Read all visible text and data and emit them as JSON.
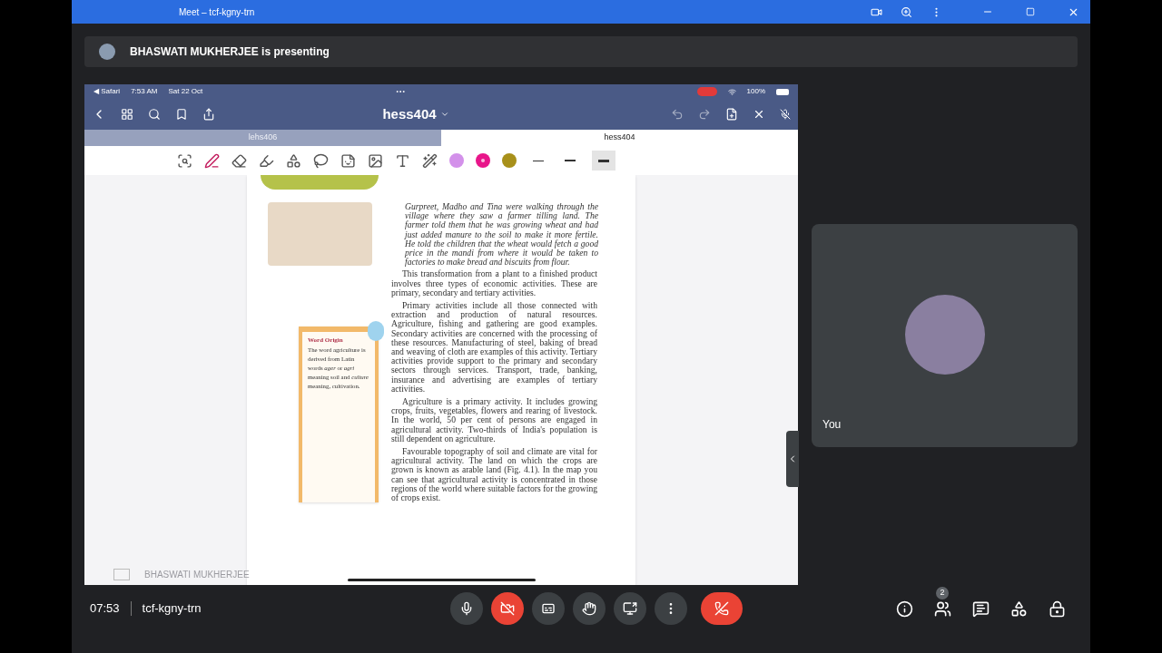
{
  "window": {
    "title": "Meet – tcf-kgny-trn"
  },
  "presenting_banner": {
    "text": "BHASWATI MUKHERJEE is presenting"
  },
  "shared_screen": {
    "status_bar": {
      "app": "◀ Safari",
      "time": "7:53 AM",
      "date": "Sat 22 Oct",
      "battery": "100%"
    },
    "document_title": "hess404",
    "tabs": [
      {
        "label": "lehs406",
        "selected": false
      },
      {
        "label": "hess404",
        "selected": true
      }
    ],
    "pen_colors": [
      {
        "color": "#d391ea",
        "selected": false
      },
      {
        "color": "#e8168a",
        "selected": true
      },
      {
        "color": "#a8901a",
        "selected": false
      }
    ],
    "stroke_widths": [
      {
        "selected": false
      },
      {
        "selected": false
      },
      {
        "selected": true
      }
    ],
    "page": {
      "intro": "Gurpreet, Madho and Tina were walking through the village where they saw a farmer tilling land. The farmer told them that he was growing wheat and had just added manure to the soil to make it more fertile. He told the children that the wheat would fetch a good price in the mandi from where it would be taken to factories to make bread and biscuits from flour.",
      "paragraphs": [
        "This transformation from a plant to a finished product involves three types of economic activities. These are primary, secondary and tertiary activities.",
        "Primary activities include all those connected with extraction and production of natural resources. Agriculture, fishing and gathering are good examples. Secondary activities are concerned with the processing of these resources. Manufacturing of steel, baking of bread and weaving of cloth are examples of this activity. Tertiary activities provide support to the primary and secondary sectors through services. Transport, trade, banking, insurance and advertising are examples of tertiary activities.",
        "Agriculture is a primary activity. It includes growing crops, fruits, vegetables, flowers and rearing of livestock. In the world, 50 per cent of persons are engaged in agricultural activity. Two-thirds of India's population is still dependent on agriculture.",
        "Favourable topography of soil and climate are vital for agricultural activity. The land on which the crops are grown is known as arable land (Fig. 4.1). In the map you can see that agricultural activity is concentrated in those regions of the world where suitable factors for the growing of crops exist."
      ],
      "word_origin": {
        "title": "Word Origin",
        "text": "The word agriculture is derived from Latin words *ager* or *agri* meaning soil and *culture* meaning, cultivation."
      }
    },
    "presenter_label": "BHASWATI MUKHERJEE"
  },
  "participant": {
    "name": "You"
  },
  "bottom_bar": {
    "time": "07:53",
    "meeting_code": "tcf-kgny-trn",
    "controls": [
      {
        "kind": "mic"
      },
      {
        "kind": "camera_off"
      },
      {
        "kind": "captions"
      },
      {
        "kind": "hand"
      },
      {
        "kind": "present"
      },
      {
        "kind": "more"
      },
      {
        "kind": "end_call"
      }
    ],
    "side_controls": [
      {
        "kind": "info"
      },
      {
        "kind": "people",
        "badge": "2"
      },
      {
        "kind": "chat"
      },
      {
        "kind": "activities"
      },
      {
        "kind": "host"
      }
    ]
  }
}
